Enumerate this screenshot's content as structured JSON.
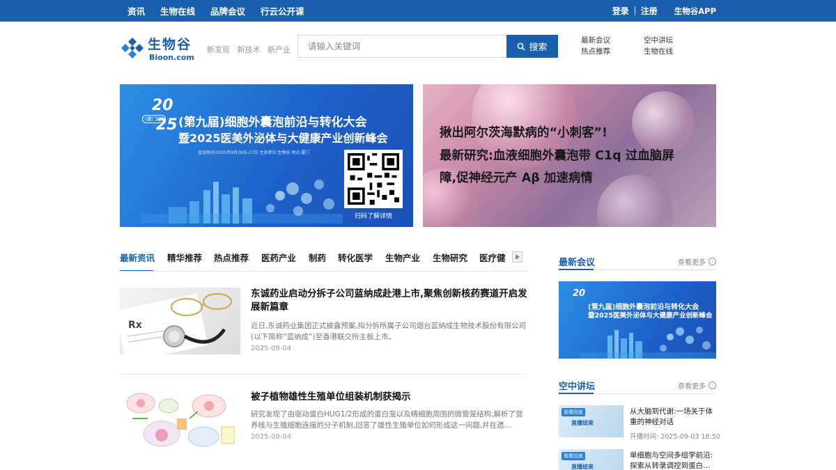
{
  "topnav": {
    "items": [
      "资讯",
      "生物在线",
      "品牌会议",
      "行云公开课"
    ],
    "login": "登录",
    "register": "注册",
    "app": "生物谷APP"
  },
  "logo": {
    "cn": "生物谷",
    "en": "Bioon.com"
  },
  "slogan": [
    "新发现",
    "新技术",
    "新产业"
  ],
  "search": {
    "placeholder": "请输入关键词",
    "button": "搜索"
  },
  "hotlinks": [
    "最新会议",
    "空中讲坛",
    "热点推荐",
    "生物在线"
  ],
  "banners": {
    "left": {
      "year_top": "20",
      "year_bottom": "25",
      "city_tag": "(厦门站)",
      "title1": "(第九届)细胞外囊泡前沿与转化大会",
      "title2": "暨2025医美外泌体与大健康产业创新峰会",
      "meta": "会议时间:2025年9月26日-27日    主办单位:生物谷    地点:厦门",
      "qr_label": "扫码了解详情"
    },
    "right": {
      "line1": "揪出阿尔茨海默病的“小刺客”!",
      "line2": "最新研究:血液细胞外囊泡带 C1q 过血脑屏",
      "line3": "障,促神经元产 Aβ 加速病情"
    }
  },
  "tabs": [
    "最新资讯",
    "精华推荐",
    "热点推荐",
    "医药产业",
    "制药",
    "转化医学",
    "生物产业",
    "生物研究",
    "医疗健"
  ],
  "articles": [
    {
      "title": "东诚药业启动分拆子公司蓝纳成赴港上市,聚焦创新核药赛道开启发展新篇章",
      "summary": "近日,东诚药业集团正式披露预案,拟分拆所属子公司烟台蓝纳成生物技术股份有限公司(以下简称“蓝纳成”)至香港联交所主板上市。",
      "date": "2025-09-04"
    },
    {
      "title": "被子植物雄性生殖单位组装机制获揭示",
      "summary": "研究发现了由驱动蛋白HUG1/2形成的蛋白笼以及精细胞周围的微管笼结构,解析了营养核与生殖细胞连接的分子机制,回答了雄性生殖单位如何形成这一问题,并在遗…",
      "date": "2025-09-04"
    }
  ],
  "sidebar": {
    "meetings": {
      "title": "最新会议",
      "more": "查看更多",
      "banner_year": "20",
      "banner_title1": "(第九届)细胞外囊泡前沿与转化大会",
      "banner_title2": "暨2025医美外泌体与大健康产业创新峰会"
    },
    "lectures": {
      "title": "空中讲坛",
      "more": "查看更多",
      "items": [
        {
          "badge": "观看回放",
          "status": "直播结束",
          "title": "从大脑到代谢:一场关于体重的神经对话",
          "time": "开播时间: 2025-09-03 18:50"
        },
        {
          "badge": "观看回放",
          "status": "直播结束",
          "title": "单细胞与空间多组学前沿:探索从转录调控到蛋白…",
          "time": ""
        }
      ]
    }
  },
  "colors": {
    "brand": "#1a5fad",
    "topbar": "#1a5fad"
  }
}
